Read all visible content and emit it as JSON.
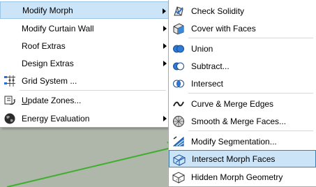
{
  "main_menu": {
    "items": [
      {
        "label": "Modify Morph",
        "has_submenu": true,
        "highlighted": true
      },
      {
        "label": "Modify Curtain Wall",
        "has_submenu": true
      },
      {
        "label": "Roof Extras",
        "has_submenu": true
      },
      {
        "label": "Design Extras",
        "has_submenu": true
      },
      {
        "label": "Grid System ...",
        "icon": "grid-system-icon"
      },
      {
        "label_pre": "U",
        "label_rest": "pdate Zones...",
        "icon": "update-zones-icon"
      },
      {
        "label": "Energy Evaluation",
        "icon": "globe-icon",
        "has_submenu": true
      }
    ]
  },
  "submenu": {
    "items": [
      {
        "label": "Check Solidity",
        "icon": "check-solidity-icon"
      },
      {
        "label": "Cover with Faces",
        "icon": "cover-faces-icon"
      },
      {
        "label": "Union",
        "icon": "union-icon"
      },
      {
        "label": "Subtract...",
        "icon": "subtract-icon"
      },
      {
        "label": "Intersect",
        "icon": "intersect-icon"
      },
      {
        "label": "Curve & Merge Edges",
        "icon": "curve-edges-icon"
      },
      {
        "label": "Smooth & Merge Faces...",
        "icon": "smooth-faces-icon"
      },
      {
        "label": "Modify Segmentation...",
        "icon": "segmentation-icon"
      },
      {
        "label": "Intersect Morph Faces",
        "icon": "intersect-morph-faces-icon",
        "highlighted": true
      },
      {
        "label": "Hidden Morph Geometry",
        "icon": "hidden-geometry-icon"
      }
    ]
  }
}
